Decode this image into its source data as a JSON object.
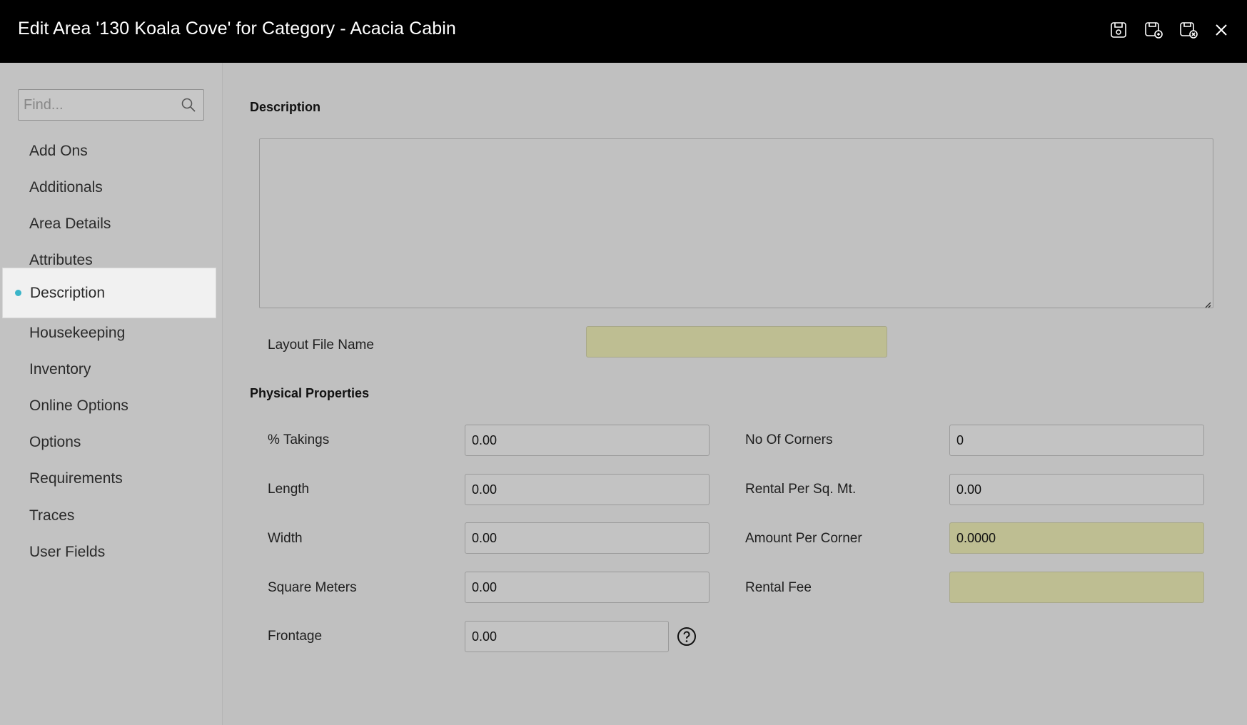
{
  "header": {
    "title": "Edit Area '130 Koala Cove' for Category - Acacia Cabin",
    "actions": [
      {
        "name": "save-icon"
      },
      {
        "name": "save-and-new-icon"
      },
      {
        "name": "save-and-close-icon"
      },
      {
        "name": "close-icon"
      }
    ]
  },
  "sidebar": {
    "search_placeholder": "Find...",
    "items": [
      {
        "label": "Add Ons"
      },
      {
        "label": "Additionals"
      },
      {
        "label": "Area Details"
      },
      {
        "label": "Attributes"
      },
      {
        "label": "Description",
        "active": true
      },
      {
        "label": "Housekeeping"
      },
      {
        "label": "Inventory"
      },
      {
        "label": "Online Options"
      },
      {
        "label": "Options"
      },
      {
        "label": "Requirements"
      },
      {
        "label": "Traces"
      },
      {
        "label": "User Fields"
      }
    ],
    "active_color": "#3bb5c9"
  },
  "main": {
    "description_title": "Description",
    "description_value": "",
    "layout_file_label": "Layout File Name",
    "layout_file_value": "",
    "physical_title": "Physical Properties",
    "fields": {
      "takings": {
        "label": "% Takings",
        "value": "0.00"
      },
      "length": {
        "label": "Length",
        "value": "0.00"
      },
      "width": {
        "label": "Width",
        "value": "0.00"
      },
      "square_meters": {
        "label": "Square Meters",
        "value": "0.00"
      },
      "frontage": {
        "label": "Frontage",
        "value": "0.00"
      },
      "no_of_corners": {
        "label": "No Of Corners",
        "value": "0"
      },
      "rental_per_sqm": {
        "label": "Rental Per Sq. Mt.",
        "value": "0.00"
      },
      "amount_per_corner": {
        "label": "Amount Per Corner",
        "value": "0.0000"
      },
      "rental_fee": {
        "label": "Rental Fee",
        "value": ""
      }
    },
    "readonly_color": "#bebe92"
  }
}
